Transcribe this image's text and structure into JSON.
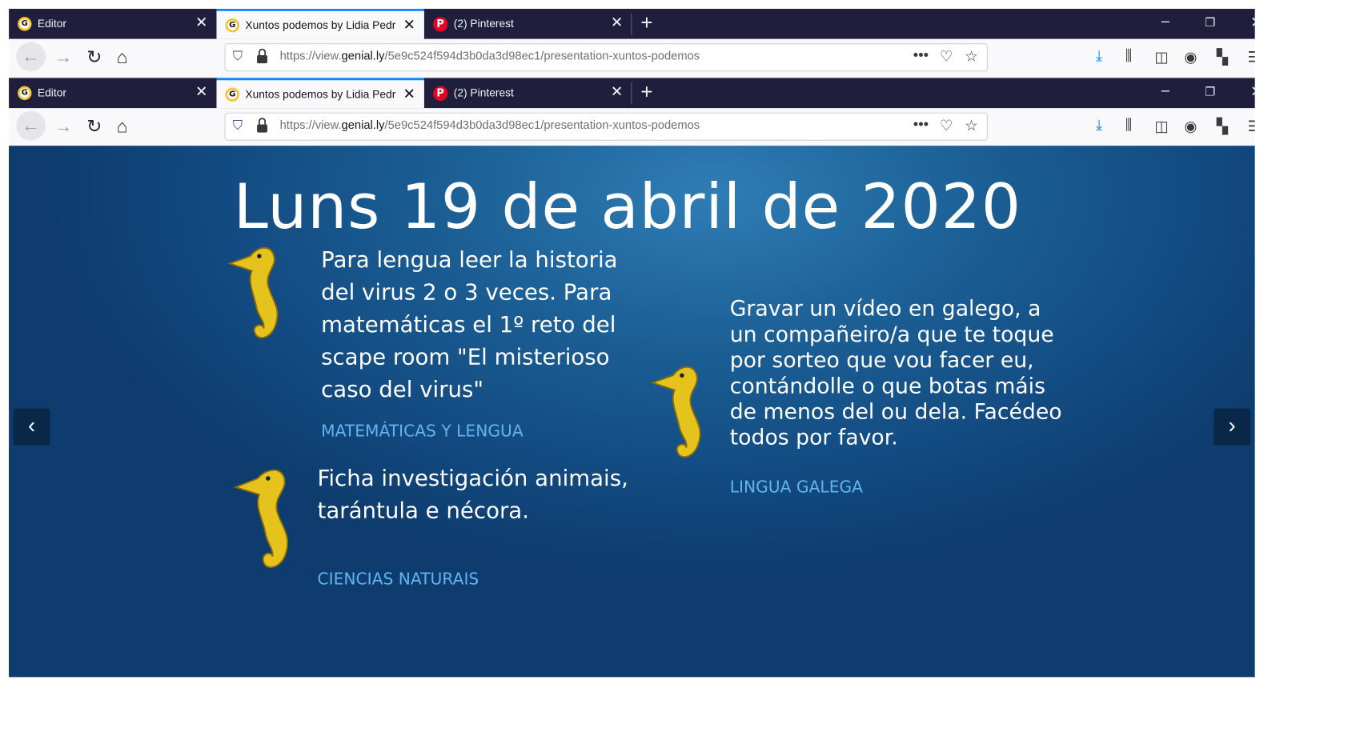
{
  "browser_chrome": [
    {
      "tabs": [
        {
          "title": "Editor",
          "close": "✕"
        },
        {
          "title": "Xuntos podemos by Lidia Pedr",
          "close": "✕"
        },
        {
          "title": "(2) Pinterest",
          "close": "✕"
        }
      ],
      "url": {
        "prefix": "https://view.",
        "domain": "genial.ly",
        "path": "/5e9c524f594d3b0da3d98ec1/presentation-xuntos-podemos"
      }
    },
    {
      "tabs": [
        {
          "title": "Editor",
          "close": "✕"
        },
        {
          "title": "Xuntos podemos by Lidia Pedr",
          "close": "✕"
        },
        {
          "title": "(2) Pinterest",
          "close": "✕"
        }
      ],
      "url": {
        "prefix": "https://view.",
        "domain": "genial.ly",
        "path": "/5e9c524f594d3b0da3d98ec1/presentation-xuntos-podemos"
      }
    }
  ],
  "slide": {
    "title": "Luns 19 de abril de 2020",
    "blocks": [
      {
        "text": "Para lengua leer la historia del virus 2 o 3 veces. Para matemáticas  el 1º reto del scape room  \"El misterioso caso del virus\"",
        "subject": "MATEMÁTICAS Y LENGUA"
      },
      {
        "text": "Ficha investigación animais, tarántula e nécora.",
        "subject": "CIENCIAS NATURAIS"
      },
      {
        "text": "Gravar un vídeo  en galego, a un compañeiro/a que te toque por sorteo que vou facer eu, contándolle o que botas máis de menos del ou dela. Facédeo todos por favor.",
        "subject": "LINGUA GALEGA"
      }
    ]
  },
  "brand": {
    "name": "genially"
  },
  "icons": {
    "prev": "chevron-left-icon",
    "next": "chevron-right-icon",
    "touch": "hand-pointer-icon",
    "more": "more-dots-icon",
    "decor": "seahorse-icon"
  },
  "colors": {
    "tab_bar": "#1f1e3d",
    "accent": "#0a84ff",
    "slide_bg": "#1b5f95",
    "subject_text": "#61b4f0"
  }
}
